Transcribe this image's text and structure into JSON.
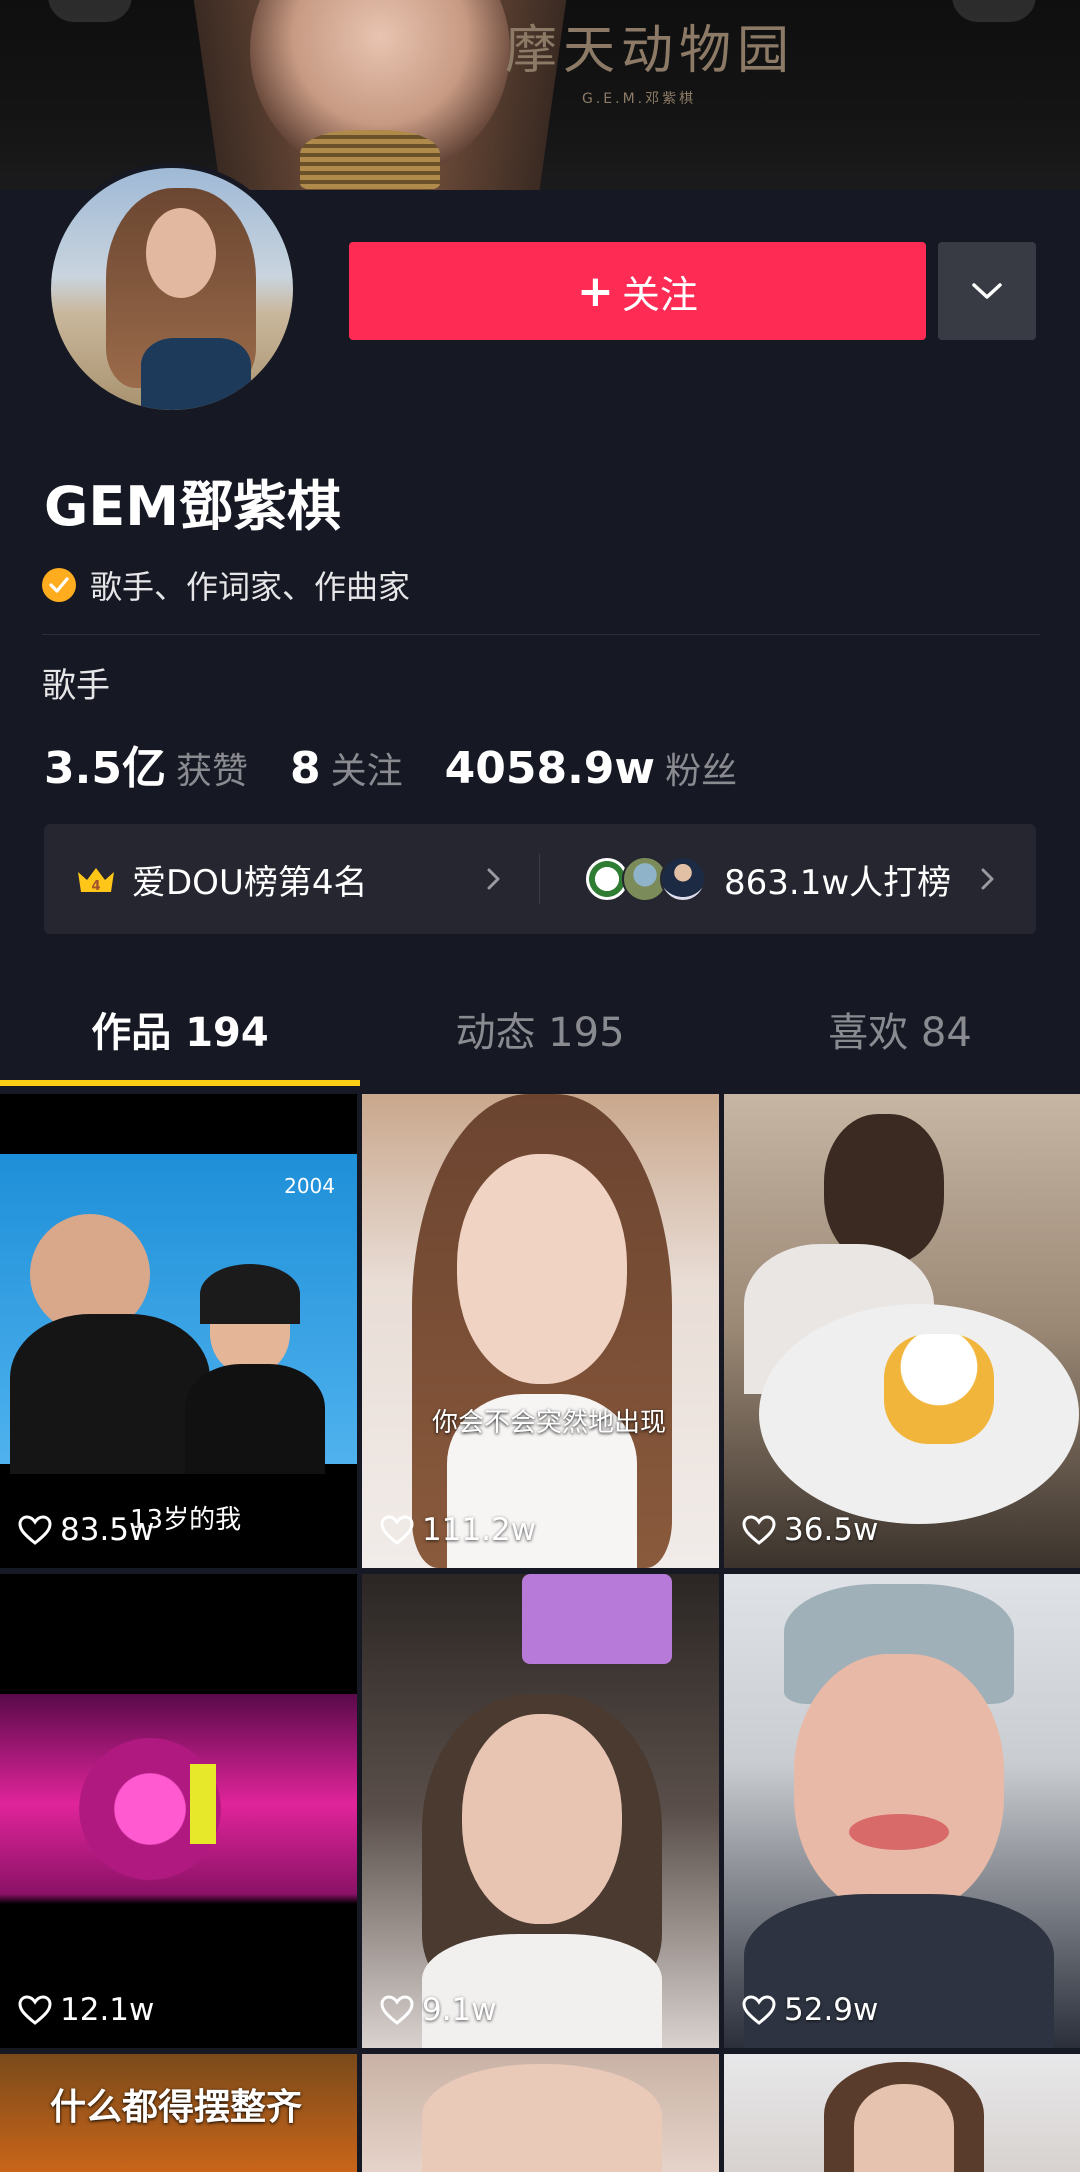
{
  "banner": {
    "title": "摩天动物园",
    "subtitle": "G.E.M.邓紫棋"
  },
  "profile": {
    "follow_label": "关注",
    "name": "GEM鄧紫棋",
    "verified_text": "歌手、作词家、作曲家",
    "bio": "歌手",
    "stats": [
      {
        "value": "3.5亿",
        "label": "获赞"
      },
      {
        "value": "8",
        "label": "关注"
      },
      {
        "value": "4058.9w",
        "label": "粉丝"
      }
    ]
  },
  "rank": {
    "crown_number": "4",
    "left_text": "爱DOU榜第4名",
    "right_text": "863.1w人打榜"
  },
  "tabs": [
    {
      "label": "作品 194"
    },
    {
      "label": "动态 195"
    },
    {
      "label": "喜欢 84"
    }
  ],
  "videos": [
    {
      "likes": "83.5w",
      "caption": "13岁的我",
      "year": "2004"
    },
    {
      "likes": "111.2w",
      "caption": "你会不会突然地出现"
    },
    {
      "likes": "36.5w"
    },
    {
      "likes": "12.1w"
    },
    {
      "likes": "9.1w"
    },
    {
      "likes": "52.9w"
    }
  ],
  "partial_caption": "什么都得摆整齐",
  "colors": {
    "background": "#161823",
    "follow_button": "#fe2c55",
    "tab_indicator": "#face15",
    "verified_badge": "#ffad1f"
  }
}
